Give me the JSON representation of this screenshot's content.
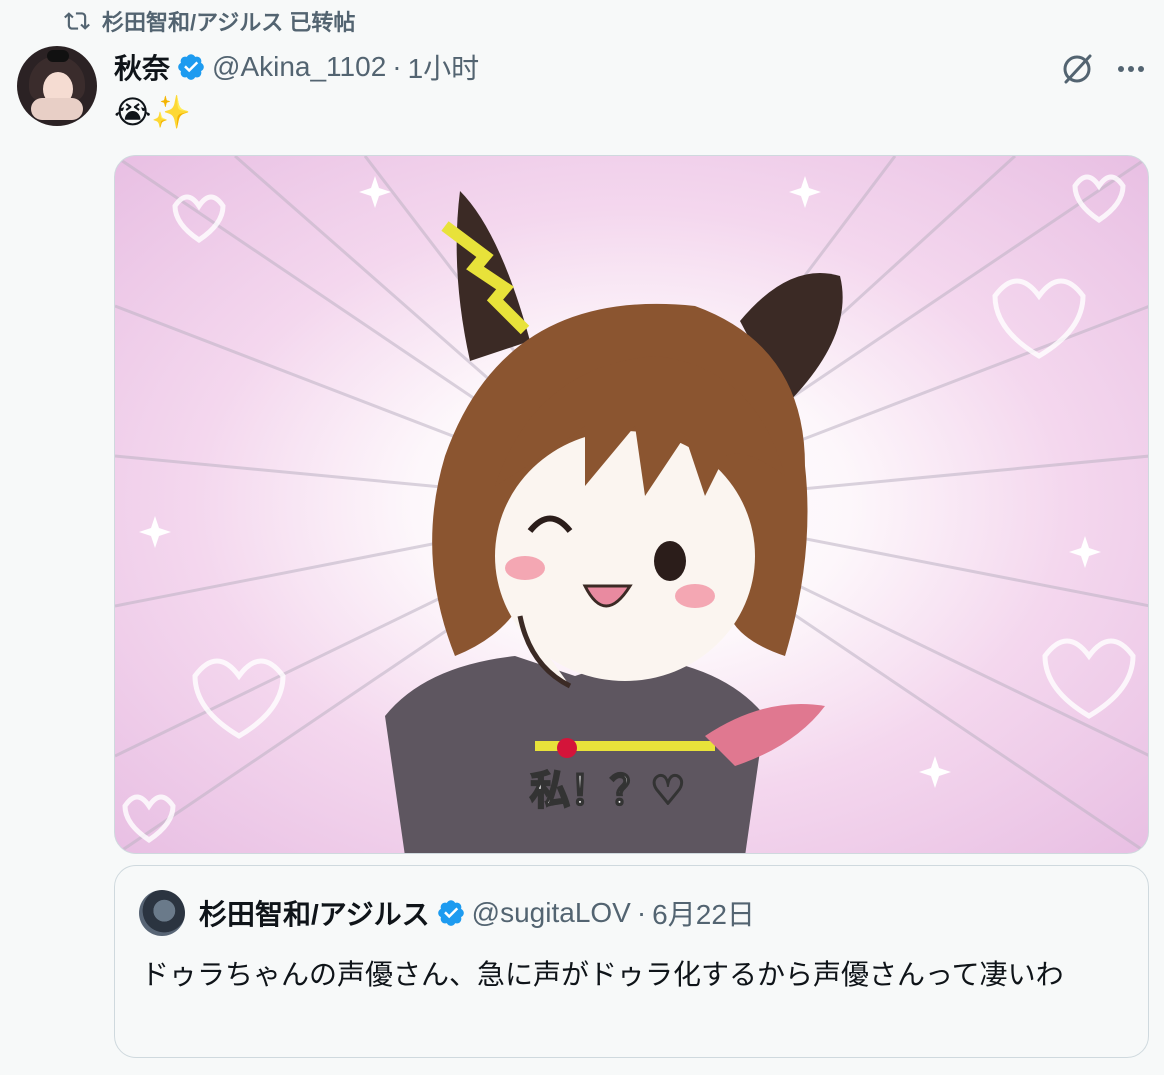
{
  "repost": {
    "icon": "retweet-icon",
    "text": "杉田智和/アジルス 已转帖"
  },
  "tweet": {
    "author_name": "秋奈",
    "handle": "@Akina_1102",
    "separator": "·",
    "time": "1小时",
    "text": "😭✨",
    "verified_color": "#1d9bf0",
    "media_caption": "私！？♡"
  },
  "quote": {
    "author_name": "杉田智和/アジルス",
    "handle": "@sugitaLOV",
    "separator": "·",
    "date": "6月22日",
    "text": "ドゥラちゃんの声優さん、急に声がドゥラ化するから声優さんって凄いわ"
  },
  "colors": {
    "muted": "#536471",
    "text": "#0f1419",
    "border": "#cfd9de",
    "background": "#f7f9f9"
  }
}
